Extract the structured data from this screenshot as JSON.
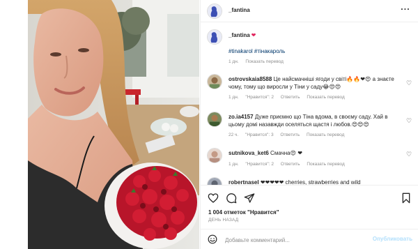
{
  "post": {
    "author": "_fantina",
    "more_icon": "more-horizontal-icon"
  },
  "caption": {
    "user": "_fantina",
    "emoji": "❤",
    "hashtags": "#tinakarol #тінакароль",
    "time": "1 дн.",
    "translate": "Показать перевод"
  },
  "comments": [
    {
      "user": "ostrovskaia8588",
      "text": "Це найсмачніші ягоди у світі🔥🔥❤😍 а знаєте чому, тому що виросли у Тіни у саду😂😍😍",
      "time": "1 дн.",
      "likes": "\"Нравится\": 2",
      "reply": "Ответить",
      "translate": "Показать перевод"
    },
    {
      "user": "zo.ia4157",
      "text": "Дуже приємно що Тіна вдома, в своєму саду. Хай в цьому домі назавжди оселяться щастя і любов.😍😍😍",
      "time": "22 ч.",
      "likes": "\"Нравится\": 3",
      "reply": "Ответить",
      "translate": "Показать перевод"
    },
    {
      "user": "sutnikova_ket6",
      "text": "Смачна😍 ❤",
      "time": "1 дн.",
      "likes": "\"Нравится\": 2",
      "reply": "Ответить",
      "translate": "Показать перевод"
    },
    {
      "user": "robertnasel",
      "text": "❤❤❤❤❤ cherries, strawberries and wild"
    }
  ],
  "actions": {
    "like_icon": "heart-outline-icon",
    "comment_icon": "comment-bubble-icon",
    "share_icon": "paper-plane-icon",
    "save_icon": "bookmark-icon"
  },
  "likes_line": "1 004 отметок \"Нравится\"",
  "time_ago": "ДЕНЬ НАЗАД",
  "comment_box": {
    "placeholder": "Добавьте комментарий...",
    "publish_label": "Опубликовать",
    "emoji_icon": "smiley-icon"
  },
  "colors": {
    "link_blue": "#00376b",
    "publish_disabled": "#b2dffc",
    "muted_text": "#8e8e8e",
    "heart_red": "#e0245e"
  }
}
